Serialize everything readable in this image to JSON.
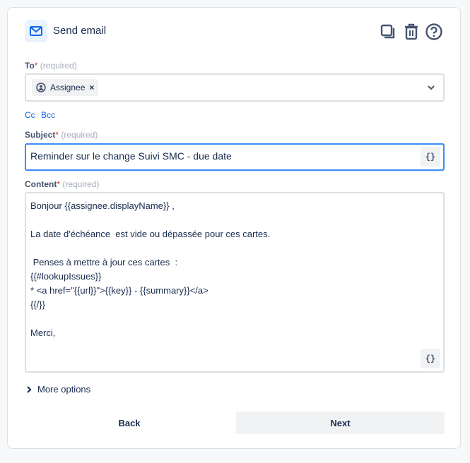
{
  "header": {
    "title": "Send email",
    "icon": "mail-icon",
    "actions": [
      "copy-icon",
      "trash-icon",
      "help-icon"
    ]
  },
  "to": {
    "label": "To",
    "star": "*",
    "required": "(required)",
    "chip": "Assignee",
    "remove": "×"
  },
  "cc": "Cc",
  "bcc": "Bcc",
  "subject": {
    "label": "Subject",
    "star": "*",
    "required": "(required)",
    "value": "Reminder sur le change Suivi SMC - due date",
    "brace": "{}"
  },
  "content": {
    "label": "Content",
    "star": "*",
    "required": "(required)",
    "brace": "{}",
    "lines": [
      "Bonjour {{assignee.displayName}} ,",
      "",
      "La date d'échéance  est vide ou dépassée pour ces cartes.",
      "",
      " Penses à mettre à jour ces cartes  :",
      "{{#lookupIssues}}",
      "* <a href=\"{{url}}\">{{key}} - {{summary}}</a>",
      "{{/}}",
      "",
      "Merci,"
    ]
  },
  "more_options": "More options",
  "buttons": {
    "back": "Back",
    "next": "Next"
  }
}
